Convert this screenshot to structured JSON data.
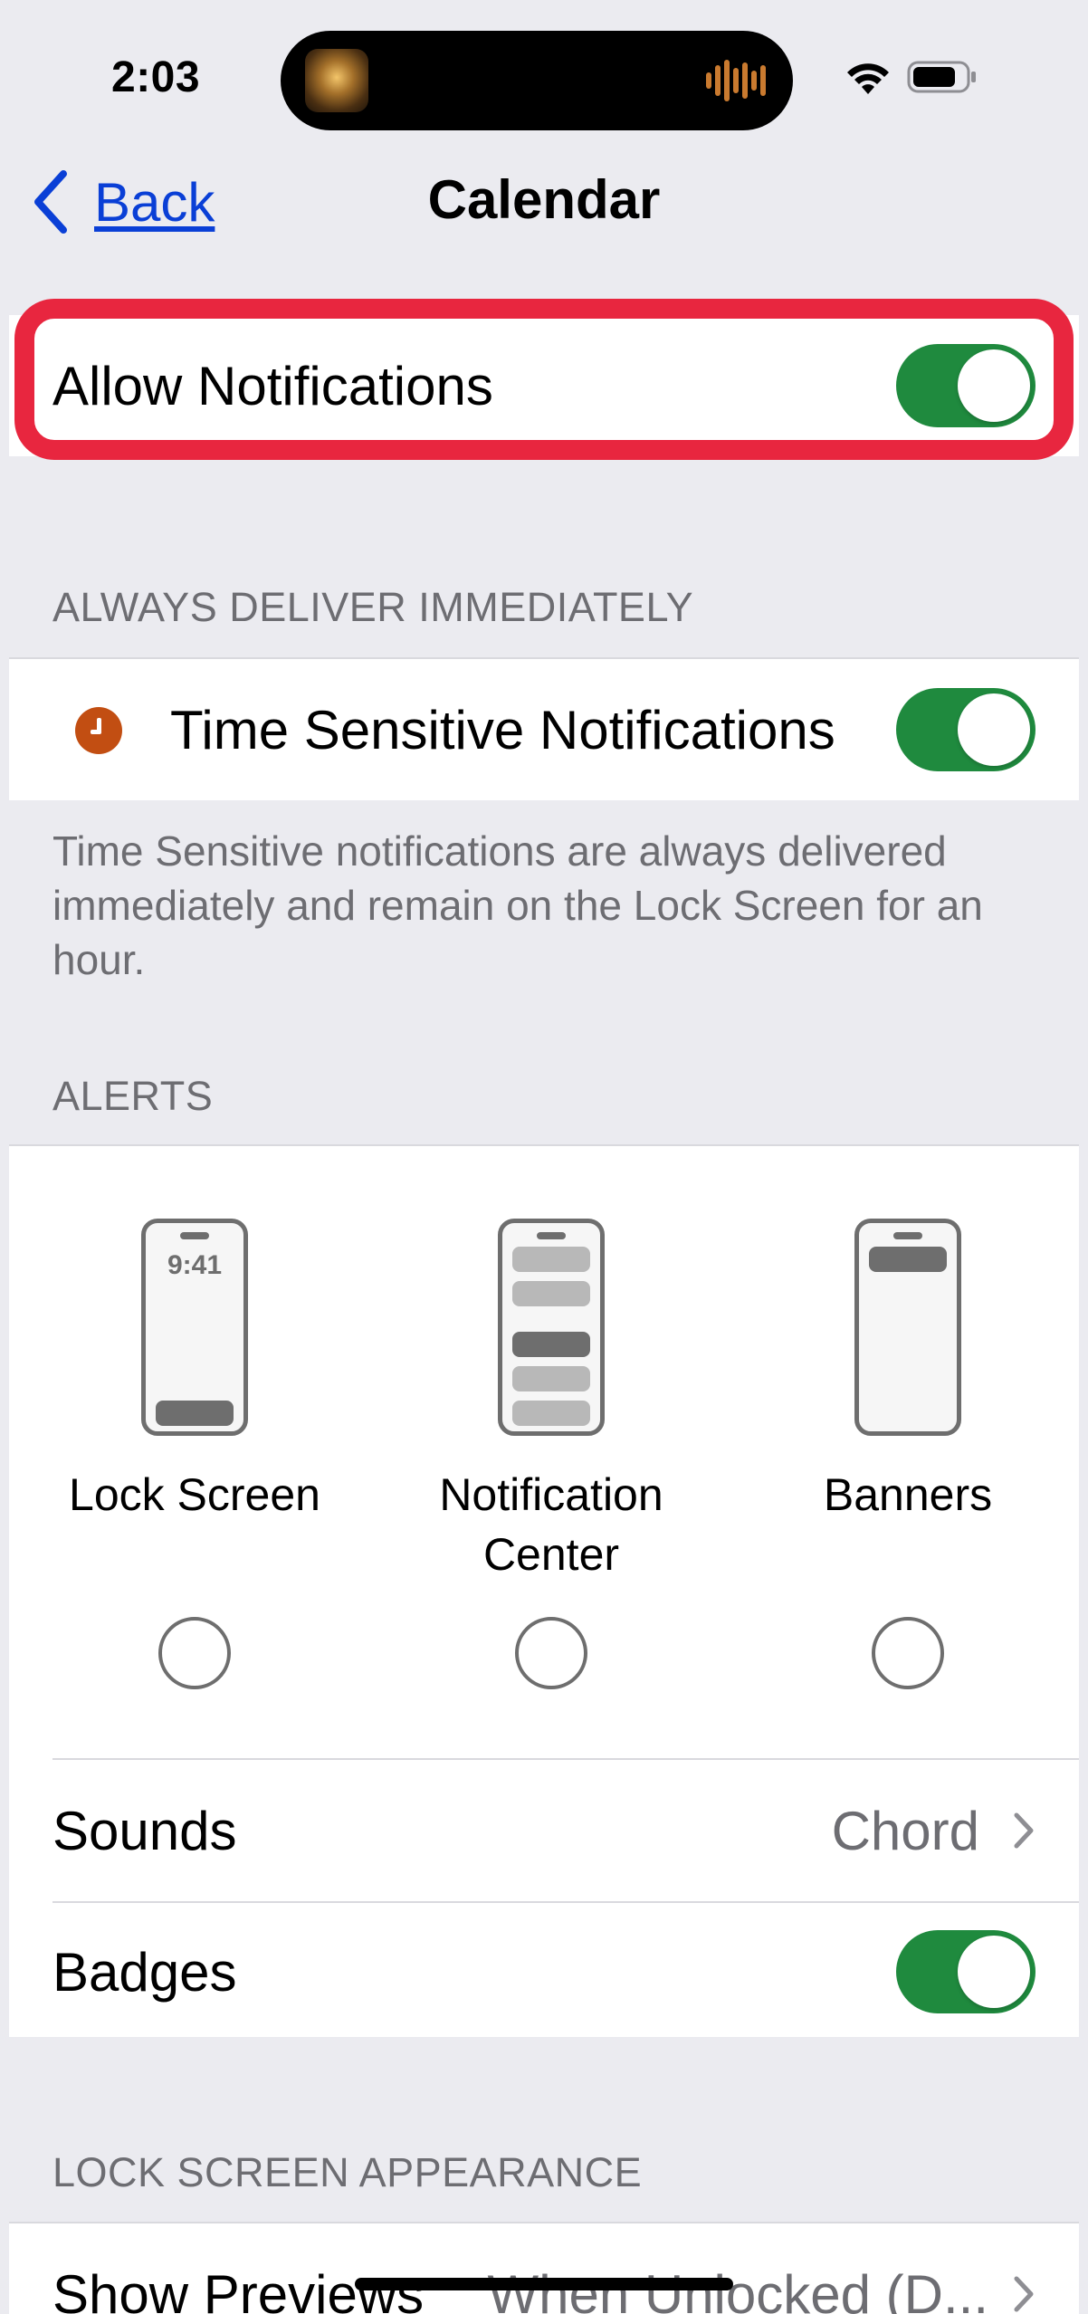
{
  "status_bar": {
    "time": "2:03"
  },
  "nav": {
    "back_label": "Back",
    "title": "Calendar"
  },
  "allow_notifications": {
    "label": "Allow Notifications",
    "enabled": true
  },
  "always_deliver": {
    "header": "ALWAYS DELIVER IMMEDIATELY",
    "time_sensitive_label": "Time Sensitive Notifications",
    "time_sensitive_enabled": true,
    "footer": "Time Sensitive notifications are always delivered immediately and remain on the Lock Screen for an hour."
  },
  "alerts": {
    "header": "ALERTS",
    "options": [
      {
        "label": "Lock Screen",
        "phone_time": "9:41",
        "selected": false
      },
      {
        "label": "Notification Center",
        "selected": false
      },
      {
        "label": "Banners",
        "selected": false
      }
    ],
    "sounds_label": "Sounds",
    "sounds_value": "Chord",
    "badges_label": "Badges",
    "badges_enabled": true
  },
  "lock_screen_appearance": {
    "header": "LOCK SCREEN APPEARANCE",
    "show_previews_label": "Show Previews",
    "show_previews_value": "When Unlocked (D..."
  },
  "colors": {
    "toggle_on": "#1f8a3e",
    "link": "#0a3fd6",
    "highlight": "#e8263f",
    "clock_icon": "#c24e12"
  },
  "icons": [
    "back-chevron-icon",
    "wifi-icon",
    "battery-icon",
    "clock-icon",
    "chevron-right-icon"
  ]
}
